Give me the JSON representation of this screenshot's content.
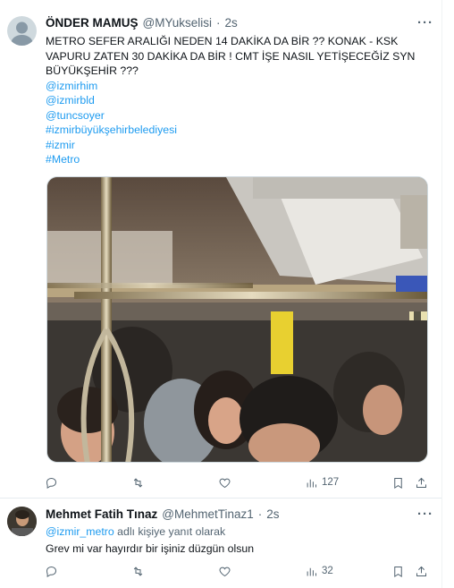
{
  "tweets": [
    {
      "author_name": "ÖNDER MAMUŞ",
      "handle": "@MYukselisi",
      "separator": "·",
      "time": "2s",
      "text": "METRO SEFER ARALIĞI NEDEN 14 DAKİKA DA BİR  ??  KONAK - KSK VAPURU ZATEN 30 DAKİKA DA BİR ! CMT İŞE NASIL YETİŞECEĞİZ SYN BÜYÜKŞEHİR ???",
      "tags": [
        "@izmirhim",
        "@izmirbld",
        "@tuncsoyer",
        "#izmirbüyükşehirbelediyesi",
        "#izmir",
        "#Metro"
      ],
      "views": "127"
    },
    {
      "author_name": "Mehmet Fatih Tınaz",
      "handle": "@MehmetTinaz1",
      "separator": "·",
      "time": "2s",
      "reply_mention": "@izmir_metro",
      "reply_suffix": " adlı kişiye yanıt olarak",
      "text": "Grev mi var hayırdır bir işiniz düzgün olsun",
      "views": "32"
    }
  ],
  "icons": [
    "more-icon",
    "reply-icon",
    "retweet-icon",
    "like-icon",
    "views-icon",
    "bookmark-icon",
    "share-icon"
  ],
  "colors": {
    "link": "#1d9bf0",
    "secondary": "#536471",
    "text": "#0f1419",
    "border": "#cfd9de"
  }
}
